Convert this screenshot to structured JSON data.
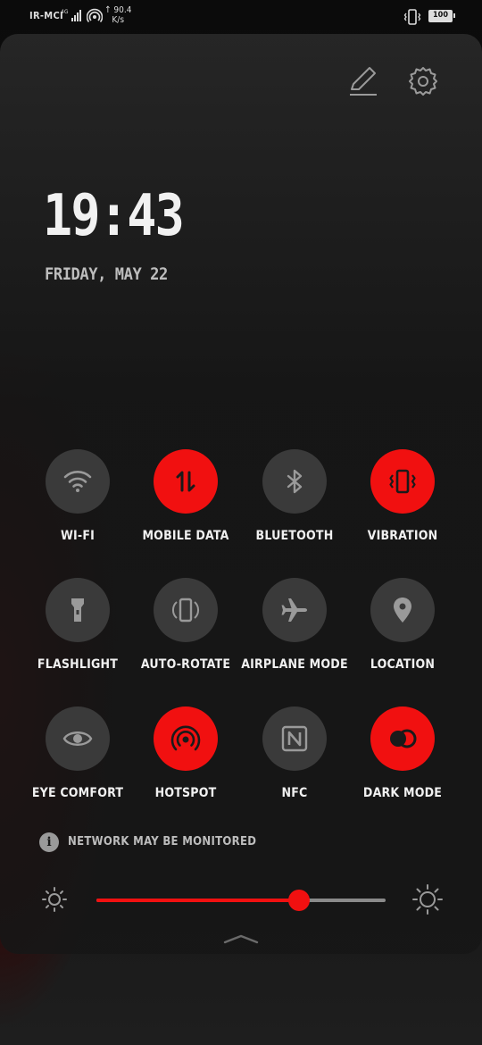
{
  "status_bar": {
    "carrier": "IR-MCI",
    "network": "4G",
    "speed_value": "90.4",
    "speed_unit": "K/s",
    "speed_arrow": "↑",
    "battery": "100",
    "icons": [
      "signal-icon",
      "hotspot-icon",
      "vibrate-icon",
      "battery-icon"
    ]
  },
  "header": {
    "icons": [
      "edit-icon",
      "gear-icon"
    ]
  },
  "clock": {
    "time": "19:43",
    "date": "FRIDAY, MAY 22"
  },
  "tiles": [
    {
      "label": "WI-FI",
      "icon": "wifi-icon",
      "on": false
    },
    {
      "label": "MOBILE DATA",
      "icon": "mobile-data-icon",
      "on": true
    },
    {
      "label": "BLUETOOTH",
      "icon": "bluetooth-icon",
      "on": false
    },
    {
      "label": "VIBRATION",
      "icon": "vibrate-icon",
      "on": true
    },
    {
      "label": "FLASHLIGHT",
      "icon": "flashlight-icon",
      "on": false
    },
    {
      "label": "AUTO-ROTATE",
      "icon": "rotate-icon",
      "on": false
    },
    {
      "label": "AIRPLANE MODE",
      "icon": "airplane-icon",
      "on": false
    },
    {
      "label": "LOCATION",
      "icon": "location-icon",
      "on": false
    },
    {
      "label": "EYE COMFORT",
      "icon": "eye-icon",
      "on": false
    },
    {
      "label": "HOTSPOT",
      "icon": "hotspot-icon",
      "on": true
    },
    {
      "label": "NFC",
      "icon": "nfc-icon",
      "on": false
    },
    {
      "label": "DARK MODE",
      "icon": "dark-mode-icon",
      "on": true
    }
  ],
  "notice": {
    "icon": "info-icon",
    "text": "NETWORK MAY BE MONITORED"
  },
  "brightness": {
    "level": 0.7,
    "icons": [
      "brightness-low-icon",
      "brightness-high-icon"
    ]
  },
  "colors": {
    "accent": "#f11010",
    "tile_off": "#3a3a3a",
    "panel": "#1c1c1c"
  }
}
